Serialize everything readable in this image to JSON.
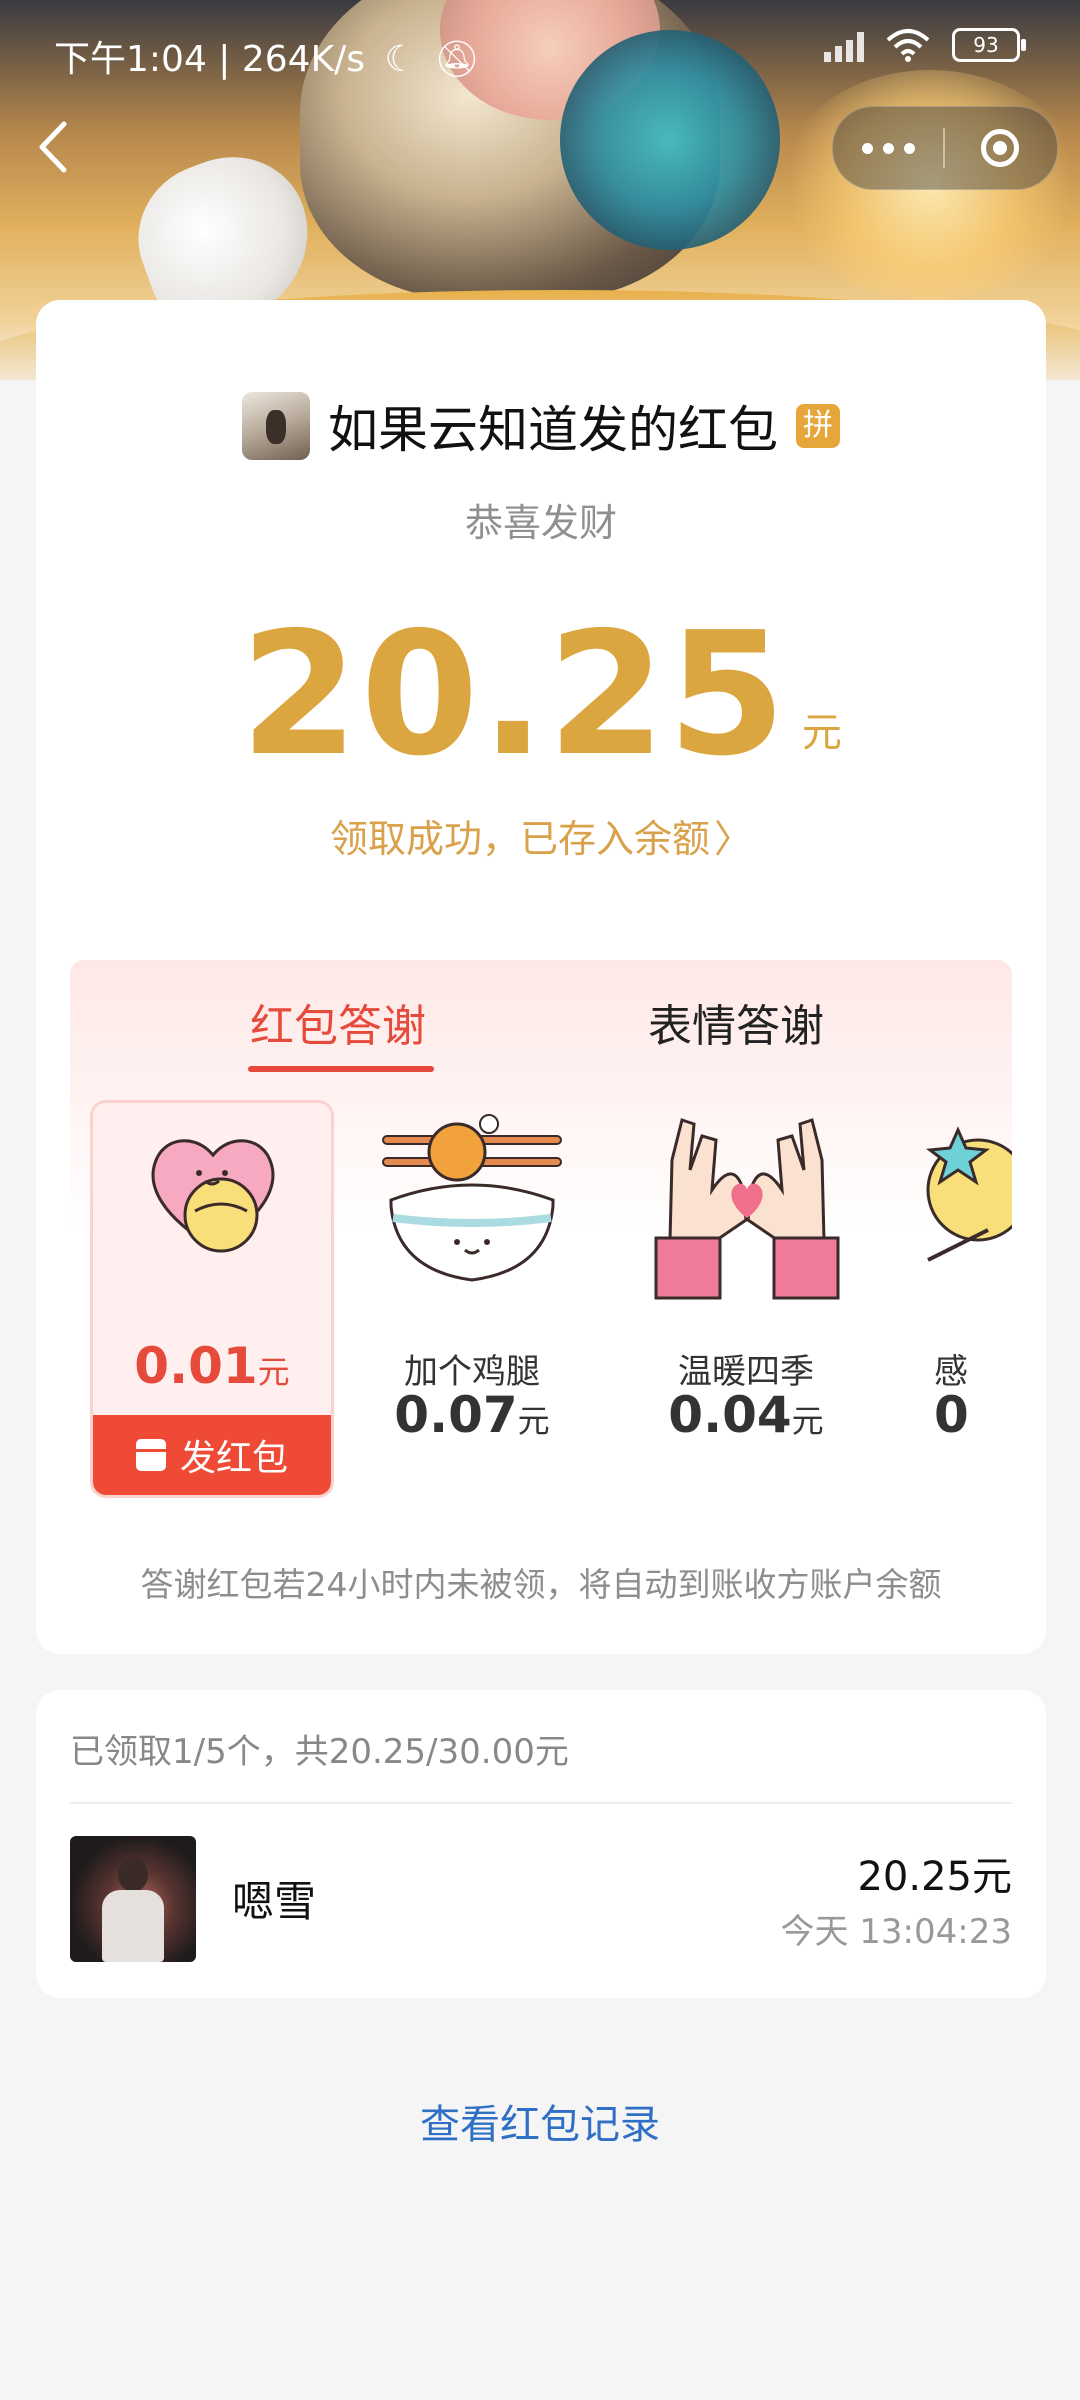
{
  "status_bar": {
    "time_speed": "下午1:04 | 264K/s",
    "battery": "93"
  },
  "colors": {
    "accent_gold": "#dba53f",
    "accent_red": "#e64a3b",
    "link_blue": "#2f6fc6"
  },
  "envelope": {
    "sender_title": "如果云知道发的红包",
    "type_badge": "拼",
    "blessing": "恭喜发财",
    "amount": "20.25",
    "unit": "元",
    "success_text": "领取成功，已存入余额"
  },
  "thanks": {
    "tabs": [
      "红包答谢",
      "表情答谢"
    ],
    "items": [
      {
        "label": "",
        "price": "0.01",
        "unit": "元",
        "icon": "heart-hug-icon"
      },
      {
        "label": "加个鸡腿",
        "price": "0.07",
        "unit": "元",
        "icon": "rice-bowl-drumstick-icon"
      },
      {
        "label": "温暖四季",
        "price": "0.04",
        "unit": "元",
        "icon": "heart-hands-icon"
      },
      {
        "label": "感",
        "price": "0",
        "unit": "",
        "icon": "star-icon"
      }
    ],
    "send_button": "发红包",
    "note": "答谢红包若24小时内未被领，将自动到账收方账户余额"
  },
  "receipts": {
    "summary": "已领取1/5个，共20.25/30.00元",
    "list": [
      {
        "name": "嗯雪",
        "amount": "20.25元",
        "time": "今天 13:04:23"
      }
    ]
  },
  "footer": {
    "history_link": "查看红包记录"
  }
}
